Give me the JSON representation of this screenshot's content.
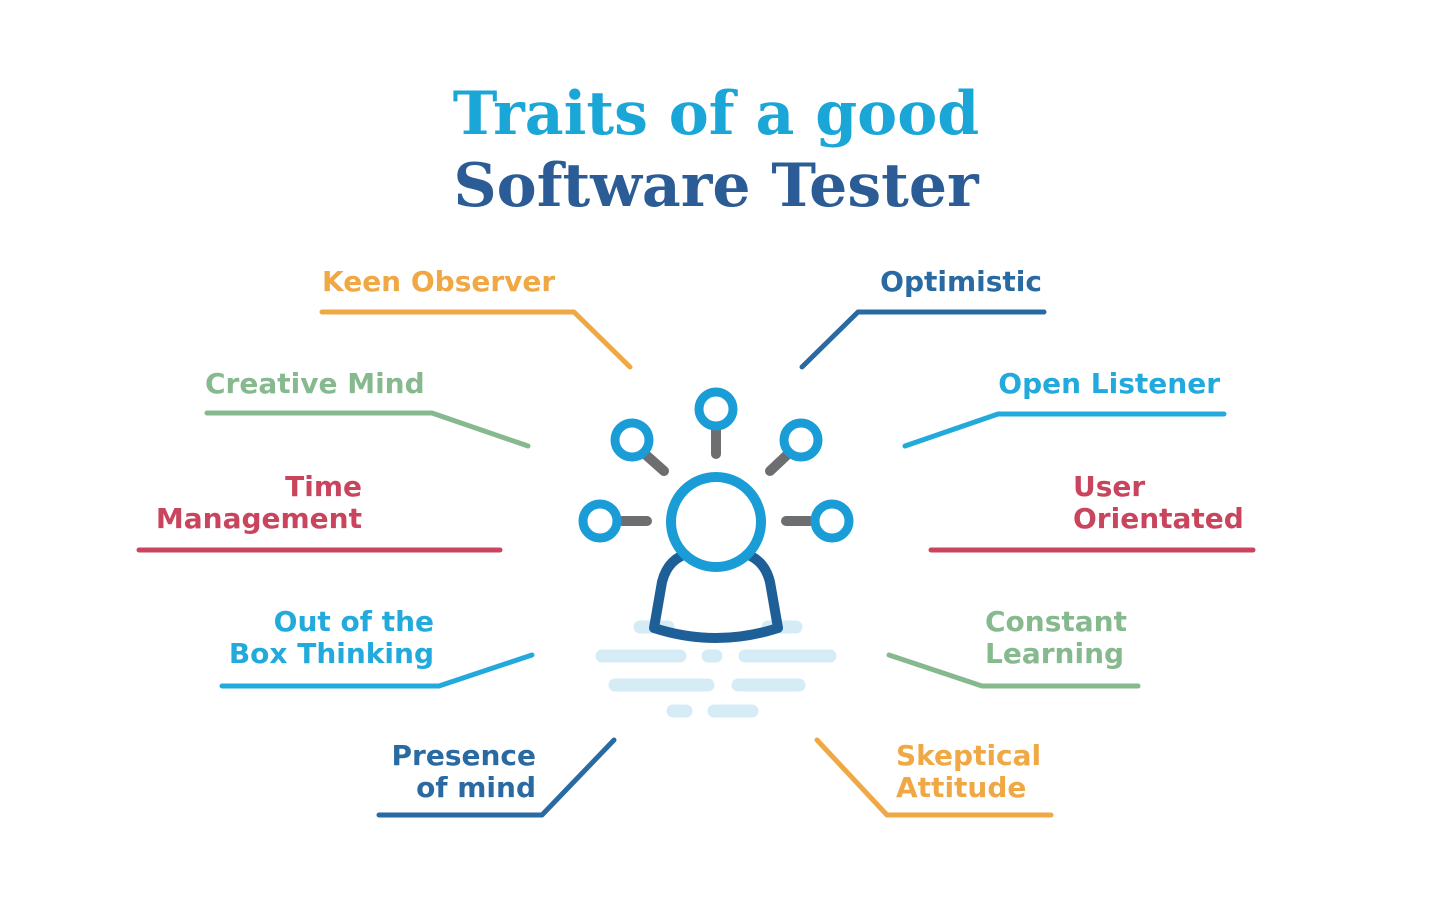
{
  "title": {
    "line1": "Traits of a good",
    "line2": "Software Tester"
  },
  "colors": {
    "title_line1": "#1aa6d6",
    "title_line2": "#2b5c95",
    "orange": "#f0a844",
    "green": "#86b98e",
    "red": "#c9455e",
    "blue_light": "#22aadc",
    "blue_dark": "#2a6aa3",
    "icon_blue": "#1a9dd6",
    "icon_navy": "#1f5f98",
    "icon_gray": "#6d6e70",
    "icon_pale": "#d5ecf7"
  },
  "traits": {
    "keen_observer": "Keen Observer",
    "creative_mind": "Creative Mind",
    "time_management": [
      "Time",
      "Management"
    ],
    "out_of_box": [
      "Out of the",
      "Box Thinking"
    ],
    "presence_of_mind": [
      "Presence",
      "of mind"
    ],
    "optimistic": "Optimistic",
    "open_listener": "Open Listener",
    "user_orientated": [
      "User",
      "Orientated"
    ],
    "constant_learning": [
      "Constant",
      "Learning"
    ],
    "skeptical_attitude": [
      "Skeptical",
      "Attitude"
    ]
  },
  "central_icon": "person-network-icon"
}
